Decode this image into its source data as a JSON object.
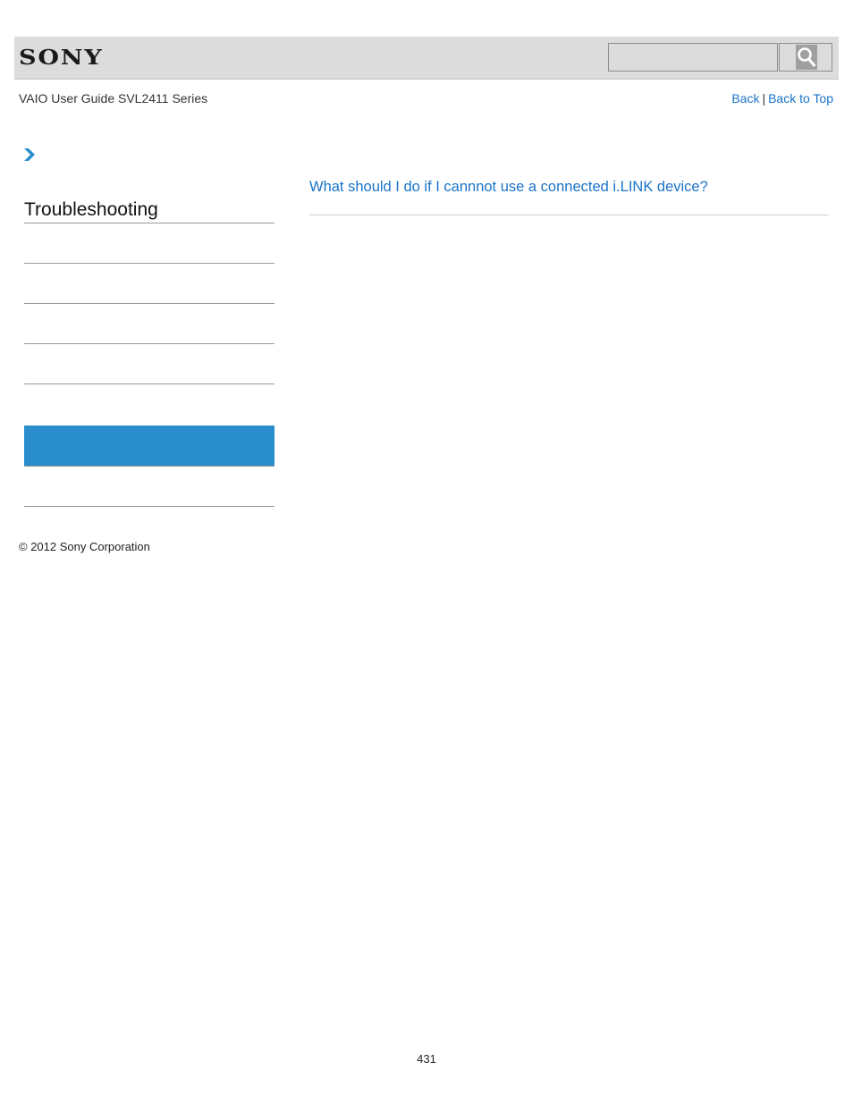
{
  "header": {
    "logo_text": "SONY",
    "search": {
      "placeholder": "",
      "value": ""
    },
    "search_icon": "search-icon"
  },
  "subheader": {
    "guide_title": "VAIO User Guide SVL2411 Series",
    "back_label": "Back",
    "separator": "|",
    "back_to_top_label": "Back to Top"
  },
  "breadcrumb": {
    "icon": "chevron-right-icon"
  },
  "sidebar": {
    "title": "Troubleshooting",
    "items": [
      {
        "label": "",
        "active": false
      },
      {
        "label": "",
        "active": false
      },
      {
        "label": "",
        "active": false
      },
      {
        "label": "",
        "active": false
      },
      {
        "label": "",
        "active": true
      },
      {
        "label": "",
        "active": false
      }
    ],
    "active_color": "#2a8ecd"
  },
  "main": {
    "links": [
      {
        "text": "What should I do if I cannnot use a connected i.LINK device?"
      }
    ],
    "link_color": "#1a73c8"
  },
  "footer": {
    "copyright": "© 2012 Sony Corporation",
    "page_number": "431"
  }
}
